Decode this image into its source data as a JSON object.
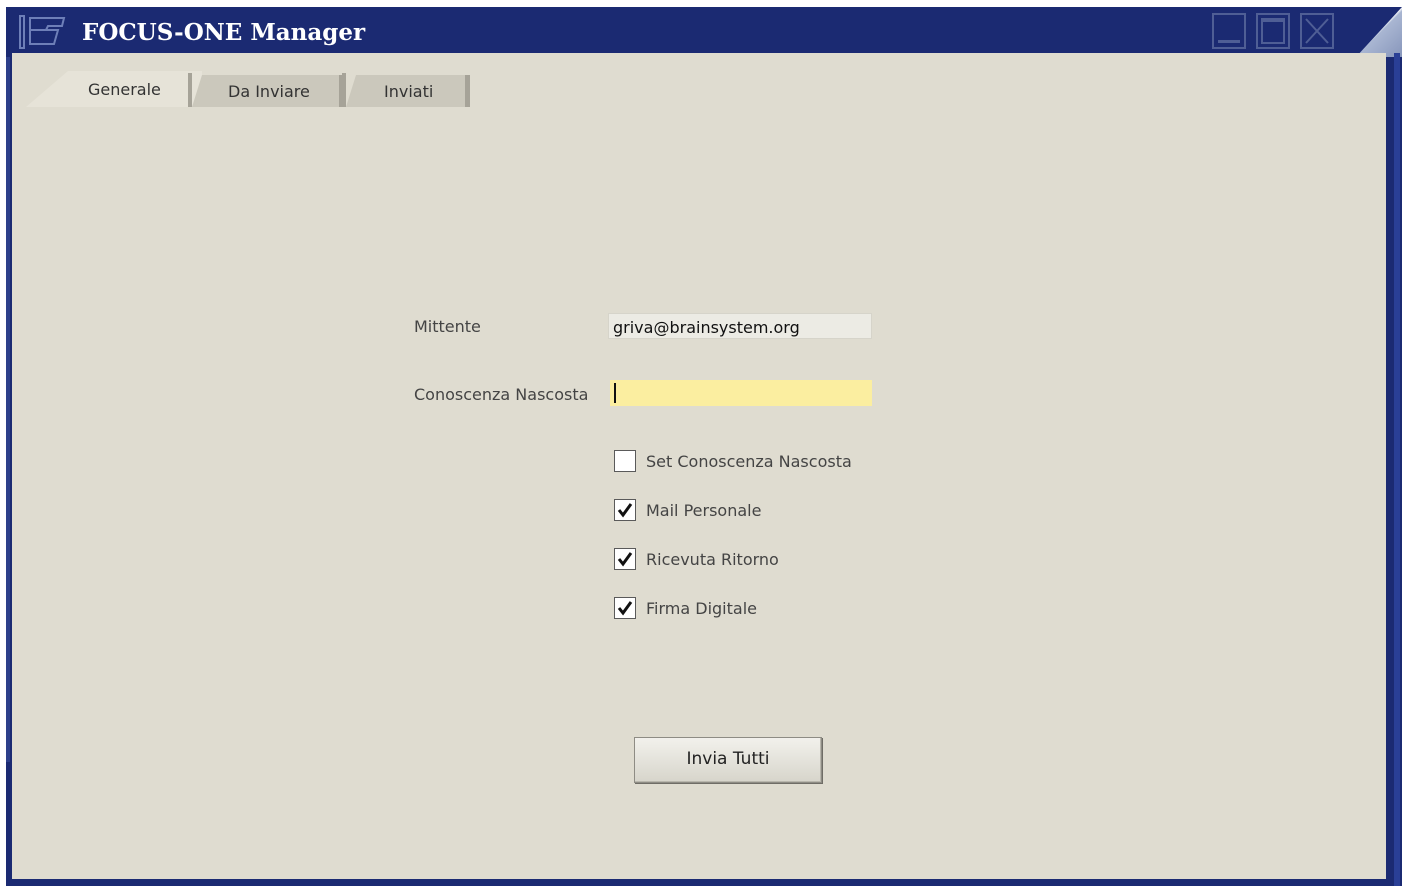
{
  "window": {
    "title": "FOCUS-ONE Manager",
    "icon": "app-window-icon",
    "controls": {
      "minimize": "minimize-icon",
      "maximize": "maximize-icon",
      "close": "close-icon"
    }
  },
  "tabs": [
    {
      "label": "Generale",
      "active": true
    },
    {
      "label": "Da Inviare",
      "active": false
    },
    {
      "label": "Inviati",
      "active": false
    }
  ],
  "form": {
    "mittente": {
      "label": "Mittente",
      "value": "griva@brainsystem.org"
    },
    "conoscenza_nascosta": {
      "label": "Conoscenza Nascosta",
      "value": ""
    },
    "checkboxes": [
      {
        "label": "Set Conoscenza Nascosta",
        "checked": false
      },
      {
        "label": "Mail Personale",
        "checked": true
      },
      {
        "label": "Ricevuta Ritorno",
        "checked": true
      },
      {
        "label": "Firma Digitale",
        "checked": true
      }
    ],
    "submit_label": "Invia Tutti"
  },
  "colors": {
    "titlebar": "#1b2a72",
    "client_bg": "#dfdcd0",
    "edit_field_bg": "#fbeea0"
  }
}
